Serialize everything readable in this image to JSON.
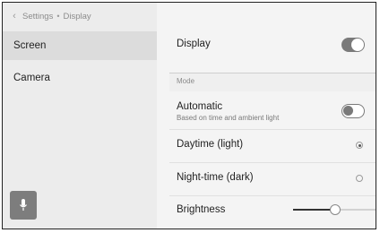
{
  "breadcrumb": {
    "back_icon": "chevron-left-icon",
    "parent": "Settings",
    "separator": "•",
    "current": "Display"
  },
  "sidebar": {
    "items": [
      {
        "label": "Screen",
        "active": true
      },
      {
        "label": "Camera",
        "active": false
      }
    ],
    "mic_icon": "microphone-icon"
  },
  "display": {
    "label": "Display",
    "enabled": true
  },
  "mode": {
    "section_label": "Mode",
    "automatic": {
      "label": "Automatic",
      "sublabel": "Based on time and ambient light",
      "enabled": false
    },
    "options": [
      {
        "label": "Daytime (light)",
        "selected": true
      },
      {
        "label": "Night-time (dark)",
        "selected": false
      }
    ]
  },
  "brightness": {
    "label": "Brightness",
    "level": 0.51
  },
  "colors": {
    "toggle": "#7a7a7a",
    "active_row": "#dcdcdc",
    "mic_button": "#7d7d7d"
  }
}
